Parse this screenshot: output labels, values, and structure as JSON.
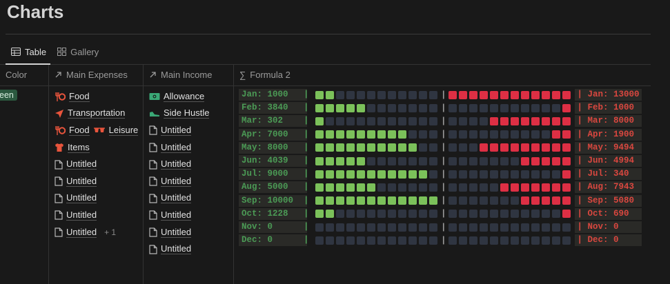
{
  "page": {
    "title": "Charts"
  },
  "tabs": [
    {
      "label": "Table",
      "icon": "table-icon"
    },
    {
      "label": "Gallery",
      "icon": "gallery-icon"
    }
  ],
  "columns": [
    {
      "label": "Color",
      "icon": ""
    },
    {
      "label": "Main Expenses",
      "icon": "arrow-up-right-icon"
    },
    {
      "label": "Main Income",
      "icon": "arrow-up-right-icon"
    },
    {
      "label": "Formula 2",
      "icon": "sigma-icon"
    }
  ],
  "color_tag": "een",
  "expenses": [
    {
      "items": [
        {
          "icon": "fork-knife-icon",
          "label": "Food"
        }
      ]
    },
    {
      "items": [
        {
          "icon": "send-icon",
          "label": "Transportation"
        }
      ]
    },
    {
      "items": [
        {
          "icon": "fork-knife-icon",
          "label": "Food"
        },
        {
          "icon": "sunglasses-icon",
          "label": "Leisure"
        }
      ]
    },
    {
      "items": [
        {
          "icon": "shirt-icon",
          "label": "Items"
        }
      ]
    },
    {
      "items": [
        {
          "icon": "page-icon",
          "label": "Untitled"
        }
      ]
    },
    {
      "items": [
        {
          "icon": "page-icon",
          "label": "Untitled"
        }
      ]
    },
    {
      "items": [
        {
          "icon": "page-icon",
          "label": "Untitled"
        }
      ]
    },
    {
      "items": [
        {
          "icon": "page-icon",
          "label": "Untitled"
        }
      ]
    },
    {
      "items": [
        {
          "icon": "page-icon",
          "label": "Untitled"
        }
      ],
      "extra": "+ 1"
    }
  ],
  "income": [
    {
      "icon": "money-icon",
      "label": "Allowance"
    },
    {
      "icon": "shoe-icon",
      "label": "Side Hustle"
    },
    {
      "icon": "page-icon",
      "label": "Untitled"
    },
    {
      "icon": "page-icon",
      "label": "Untitled"
    },
    {
      "icon": "page-icon",
      "label": "Untitled"
    },
    {
      "icon": "page-icon",
      "label": "Untitled"
    },
    {
      "icon": "page-icon",
      "label": "Untitled"
    },
    {
      "icon": "page-icon",
      "label": "Untitled"
    },
    {
      "icon": "page-icon",
      "label": "Untitled"
    },
    {
      "icon": "page-icon",
      "label": "Untitled"
    }
  ],
  "formula": {
    "colors": {
      "income": "#7bc15a",
      "expense": "#dd2f44",
      "empty": "#2f3541",
      "income_text": "#4b9a55",
      "expense_text": "#d9473f"
    },
    "squares_per_side": 12,
    "months": [
      {
        "left": "Jan: 1000   |",
        "income_filled": 2,
        "expense_filled": 12,
        "right": "| Jan: 13000"
      },
      {
        "left": "Feb: 3840   |",
        "income_filled": 5,
        "expense_filled": 1,
        "right": "| Feb: 1000"
      },
      {
        "left": "Mar: 302    |",
        "income_filled": 1,
        "expense_filled": 8,
        "right": "| Mar: 8000"
      },
      {
        "left": "Apr: 7000   |",
        "income_filled": 9,
        "expense_filled": 2,
        "right": "| Apr: 1900"
      },
      {
        "left": "May: 8000   |",
        "income_filled": 10,
        "expense_filled": 9,
        "right": "| May: 9494"
      },
      {
        "left": "Jun: 4039   |",
        "income_filled": 5,
        "expense_filled": 5,
        "right": "| Jun: 4994"
      },
      {
        "left": "Jul: 9000   |",
        "income_filled": 11,
        "expense_filled": 1,
        "right": "| Jul: 340"
      },
      {
        "left": "Aug: 5000   |",
        "income_filled": 6,
        "expense_filled": 7,
        "right": "| Aug: 7943"
      },
      {
        "left": "Sep: 10000  |",
        "income_filled": 12,
        "expense_filled": 5,
        "right": "| Sep: 5080"
      },
      {
        "left": "Oct: 1228   |",
        "income_filled": 2,
        "expense_filled": 1,
        "right": "| Oct: 690"
      },
      {
        "left": "Nov: 0      |",
        "income_filled": 0,
        "expense_filled": 0,
        "right": "| Nov: 0"
      },
      {
        "left": "Dec: 0      |",
        "income_filled": 0,
        "expense_filled": 0,
        "right": "| Dec: 0"
      }
    ],
    "divider": "|"
  }
}
